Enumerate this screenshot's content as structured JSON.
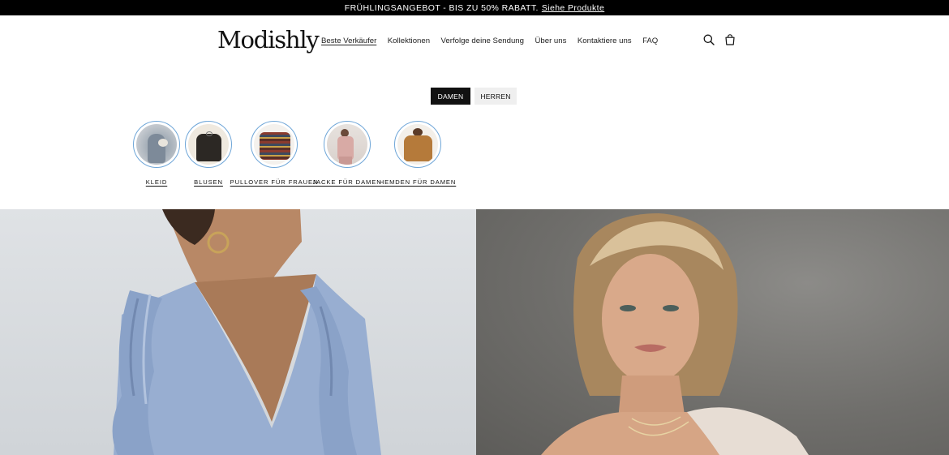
{
  "announcement": {
    "text": "FRÜHLINGSANGEBOT - BIS ZU 50% RABATT.",
    "link": "Siehe Produkte"
  },
  "header": {
    "logo": "Modishly",
    "nav": [
      {
        "label": "Beste Verkäufer",
        "active": true
      },
      {
        "label": "Kollektionen"
      },
      {
        "label": "Verfolge deine Sendung"
      },
      {
        "label": "Über uns"
      },
      {
        "label": "Kontaktiere uns"
      },
      {
        "label": "FAQ"
      }
    ],
    "icons": [
      "search-icon",
      "cart-icon"
    ]
  },
  "tabs": {
    "damen": "DAMEN",
    "herren": "HERREN",
    "selected": "DAMEN"
  },
  "categories": [
    {
      "label": "KLEID"
    },
    {
      "label": "BLUSEN"
    },
    {
      "label": "PULLOVER FÜR FRAUEN"
    },
    {
      "label": "JACKE FÜR DAMEN"
    },
    {
      "label": "HEMDEN FÜR DAMEN"
    }
  ],
  "colors": {
    "announcement_bg": "#000000",
    "circle_border": "#6fa6d8",
    "tab_active_bg": "#111111",
    "tab_inactive_bg": "#efefef"
  }
}
